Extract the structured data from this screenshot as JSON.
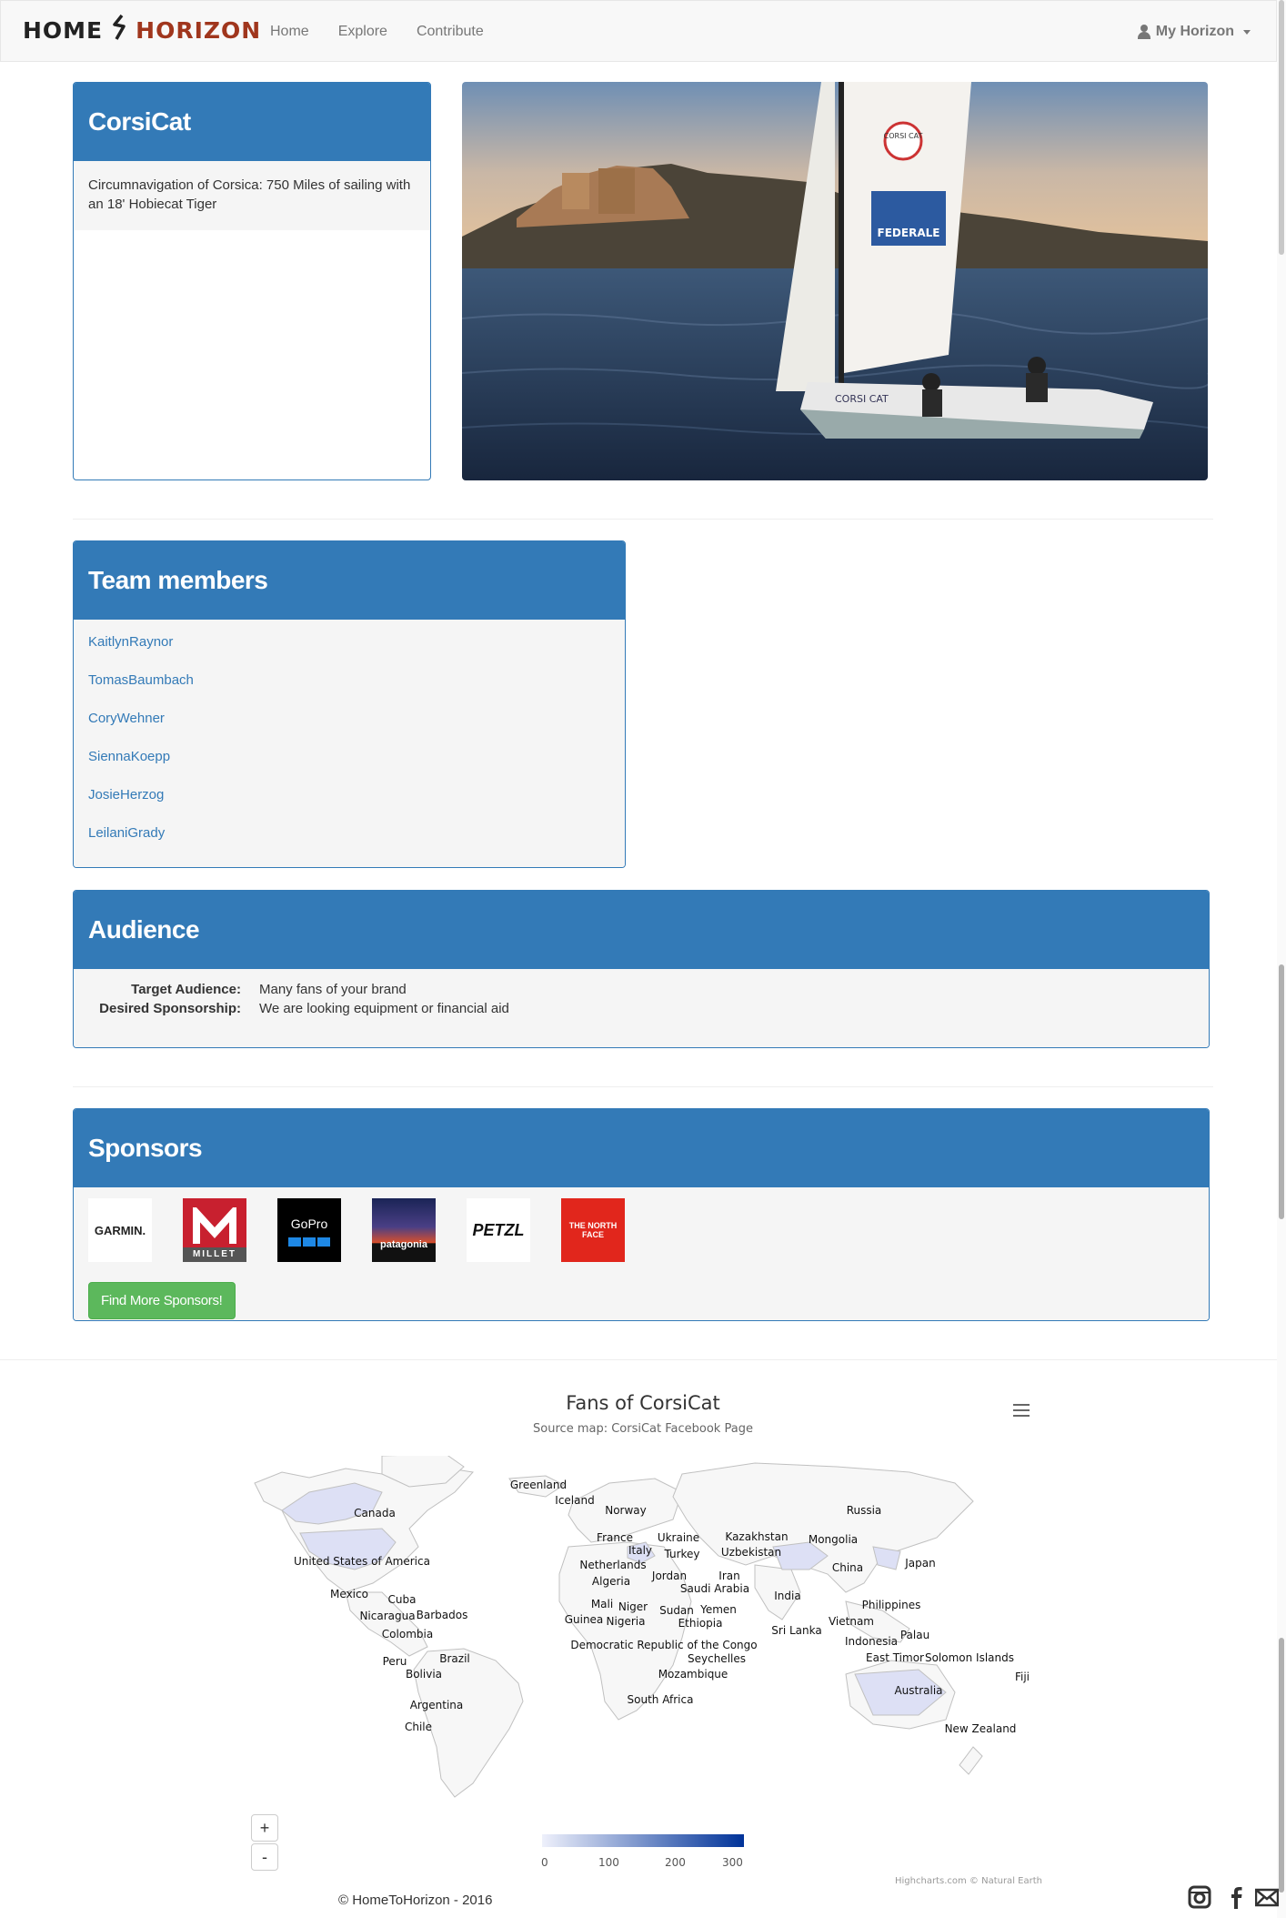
{
  "navbar": {
    "brand_home": "HOME",
    "brand_horizon": "HORIZON",
    "links": [
      "Home",
      "Explore",
      "Contribute"
    ],
    "user_menu": "My Horizon"
  },
  "project": {
    "title": "CorsiCat",
    "description": "Circumnavigation of Corsica: 750 Miles of sailing with an 18' Hobiecat Tiger"
  },
  "photo": {
    "sail_logo": "CORSI CAT",
    "banner": "FEDERALE",
    "hull_text": "CORSI CAT"
  },
  "team": {
    "title": "Team members",
    "members": [
      "KaitlynRaynor",
      "TomasBaumbach",
      "CoryWehner",
      "SiennaKoepp",
      "JosieHerzog",
      "LeilaniGrady"
    ]
  },
  "audience": {
    "title": "Audience",
    "target_label": "Target Audience:",
    "target_value": "Many fans of your brand",
    "sponsorship_label": "Desired Sponsorship:",
    "sponsorship_value": "We are looking equipment or financial aid"
  },
  "sponsors": {
    "title": "Sponsors",
    "logos": [
      "GARMIN.",
      "MILLET",
      "GoPro",
      "patagonia",
      "PETZL",
      "THE NORTH FACE"
    ],
    "button": "Find More Sponsors!"
  },
  "map": {
    "title": "Fans of CorsiCat",
    "subtitle": "Source map: CorsiCat Facebook Page",
    "countries": [
      "Greenland",
      "Iceland",
      "Canada",
      "Norway",
      "Russia",
      "France",
      "Ukraine",
      "Kazakhstan",
      "Mongolia",
      "Italy",
      "Turkey",
      "Uzbekistan",
      "United States of America",
      "Netherlands",
      "China",
      "Japan",
      "Jordan",
      "Iran",
      "Algeria",
      "Saudi Arabia",
      "Mexico",
      "Cuba",
      "Mali",
      "Niger",
      "India",
      "Philippines",
      "Sudan",
      "Yemen",
      "Nicaragua",
      "Barbados",
      "Guinea",
      "Nigeria",
      "Ethiopia",
      "Vietnam",
      "Sri Lanka",
      "Colombia",
      "Palau",
      "Democratic Republic of the Congo",
      "Indonesia",
      "Peru",
      "Brazil",
      "Seychelles",
      "East Timor",
      "Solomon Islands",
      "Bolivia",
      "Mozambique",
      "Fiji",
      "Australia",
      "South Africa",
      "Argentina",
      "Chile",
      "New Zealand"
    ],
    "zoom_in": "+",
    "zoom_out": "-",
    "legend_ticks": [
      "0",
      "100",
      "200",
      "300"
    ],
    "credits": "Highcharts.com © Natural Earth",
    "colors": {
      "low": "#eef0fb",
      "high": "#003399"
    }
  },
  "footer": {
    "copyright": "© HomeToHorizon - 2016",
    "icons": [
      "instagram-icon",
      "facebook-icon",
      "mail-icon"
    ]
  }
}
